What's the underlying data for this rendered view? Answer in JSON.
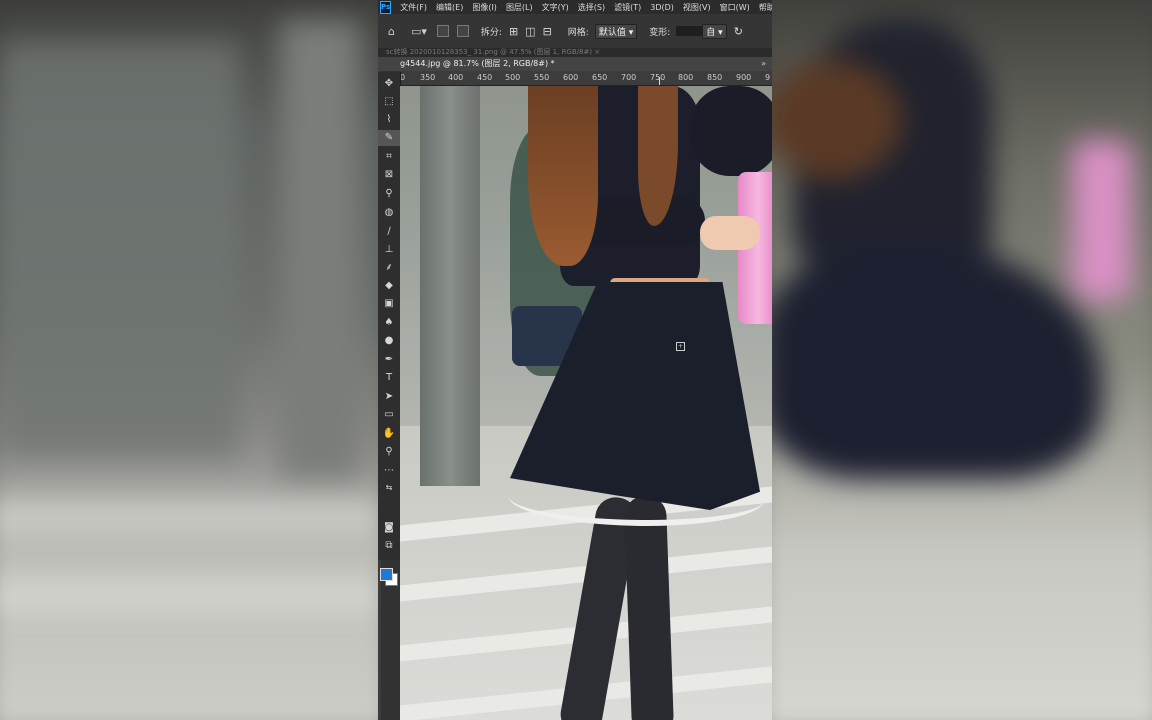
{
  "menubar": {
    "logo": "Ps",
    "items": [
      "文件(F)",
      "编辑(E)",
      "图像(I)",
      "图层(L)",
      "文字(Y)",
      "选择(S)",
      "滤镜(T)",
      "3D(D)",
      "视图(V)",
      "窗口(W)",
      "帮助(H"
    ]
  },
  "options_bar": {
    "split_label": "拆分:",
    "grid_label": "网格:",
    "grid_value": "默认值",
    "deform_label": "变形:",
    "deform_value": "自"
  },
  "document": {
    "inactive_tab": "sc转换 2020010128353_ 31.png @ 47.5% (图层 1, RGB/8#) ×",
    "active_tab": "g4544.jpg @ 81.7% (图层 2, RGB/8#) *",
    "tab_more": "»"
  },
  "ruler": {
    "labels": [
      "0",
      "350",
      "400",
      "450",
      "500",
      "550",
      "600",
      "650",
      "700",
      "750",
      "800",
      "850",
      "900",
      "9"
    ]
  },
  "tools": [
    {
      "name": "move-tool",
      "glyph": "✥"
    },
    {
      "name": "marquee-tool",
      "glyph": "⬚"
    },
    {
      "name": "lasso-tool",
      "glyph": "⌇"
    },
    {
      "name": "quick-select-tool",
      "glyph": "✎"
    },
    {
      "name": "crop-tool",
      "glyph": "⌗"
    },
    {
      "name": "frame-tool",
      "glyph": "⊠"
    },
    {
      "name": "eyedropper-tool",
      "glyph": "⚲"
    },
    {
      "name": "healing-brush-tool",
      "glyph": "◍"
    },
    {
      "name": "brush-tool",
      "glyph": "∕"
    },
    {
      "name": "clone-stamp-tool",
      "glyph": "⊥"
    },
    {
      "name": "history-brush-tool",
      "glyph": "⸙"
    },
    {
      "name": "eraser-tool",
      "glyph": "◆"
    },
    {
      "name": "gradient-tool",
      "glyph": "▣"
    },
    {
      "name": "blur-tool",
      "glyph": "♠"
    },
    {
      "name": "dodge-tool",
      "glyph": "●"
    },
    {
      "name": "pen-tool",
      "glyph": "✒"
    },
    {
      "name": "type-tool",
      "glyph": "T"
    },
    {
      "name": "path-select-tool",
      "glyph": "➤"
    },
    {
      "name": "rectangle-tool",
      "glyph": "▭"
    },
    {
      "name": "hand-tool",
      "glyph": "✋"
    },
    {
      "name": "zoom-tool",
      "glyph": "⚲"
    },
    {
      "name": "more-tools",
      "glyph": "⋯"
    }
  ],
  "colors": {
    "foreground": "#1f7ad6",
    "background": "#ffffff",
    "ps_accent": "#31a8ff"
  }
}
